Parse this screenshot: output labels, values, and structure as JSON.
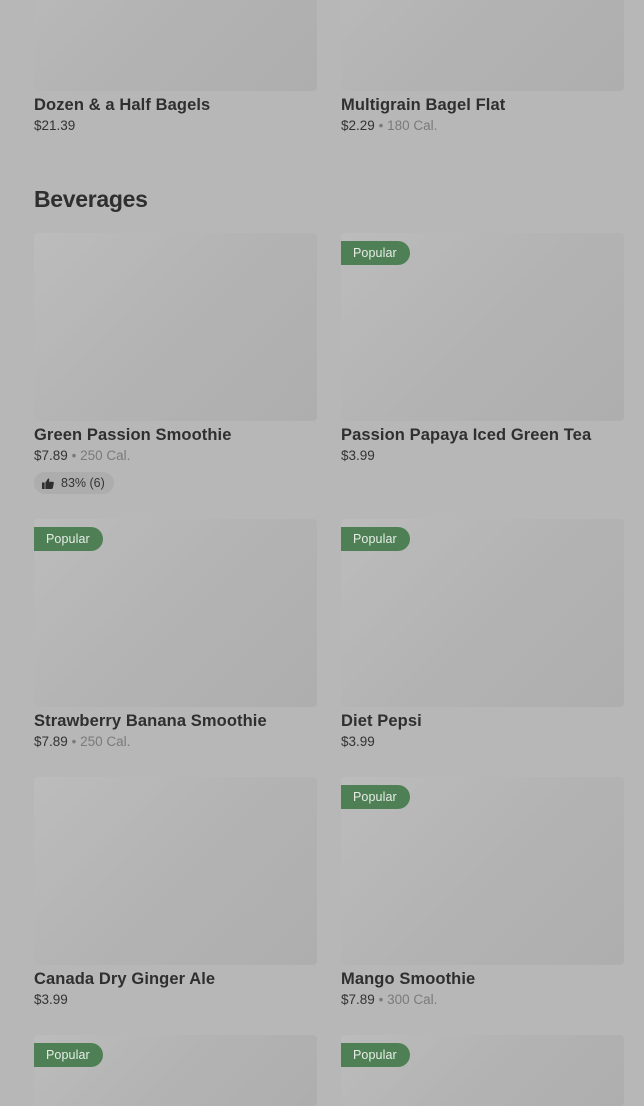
{
  "top_items": [
    {
      "name": "Dozen & a Half Bagels",
      "price": "$21.39",
      "calories": ""
    },
    {
      "name": "Multigrain Bagel Flat",
      "price": "$2.29",
      "calories": "180 Cal."
    }
  ],
  "separator": "•",
  "section": {
    "title": "Beverages",
    "items": [
      {
        "name": "Green Passion Smoothie",
        "price": "$7.89",
        "calories": "250 Cal.",
        "badge": "",
        "rating": "83% (6)"
      },
      {
        "name": "Passion Papaya Iced Green Tea",
        "price": "$3.99",
        "calories": "",
        "badge": "Popular"
      },
      {
        "name": "Strawberry Banana Smoothie",
        "price": "$7.89",
        "calories": "250 Cal.",
        "badge": "Popular"
      },
      {
        "name": "Diet Pepsi",
        "price": "$3.99",
        "calories": "",
        "badge": "Popular"
      },
      {
        "name": "Canada Dry Ginger Ale",
        "price": "$3.99",
        "calories": "",
        "badge": ""
      },
      {
        "name": "Mango Smoothie",
        "price": "$7.89",
        "calories": "300 Cal.",
        "badge": "Popular"
      },
      {
        "name": "",
        "price": "",
        "calories": "",
        "badge": "Popular"
      },
      {
        "name": "",
        "price": "",
        "calories": "",
        "badge": "Popular"
      }
    ]
  },
  "icons": {
    "rating": "thumbs-up-icon"
  },
  "colors": {
    "badge": "#4f8055",
    "overlay_bg": "#b7b7b7"
  }
}
